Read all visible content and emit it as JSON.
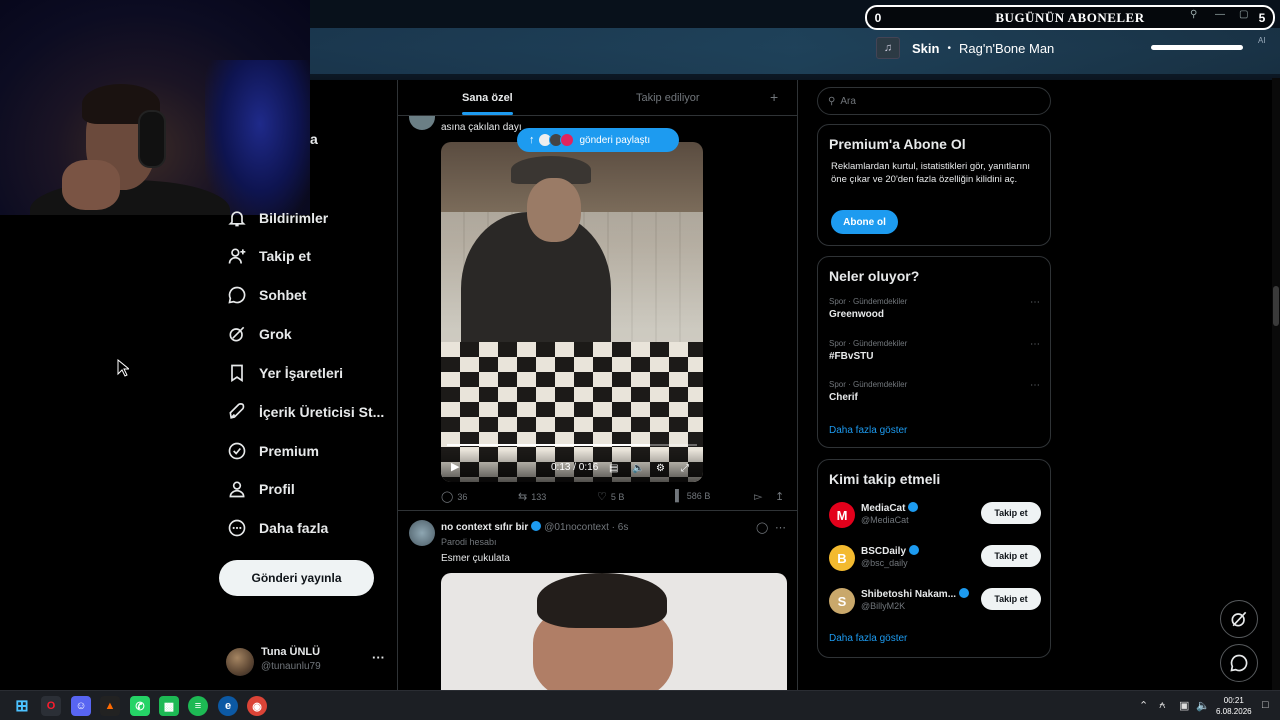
{
  "stream": {
    "subscriber_widget": {
      "count": "0",
      "title": "BUGÜNÜN ABONELER",
      "right_value": "5",
      "ai_tag": "AI"
    },
    "now_playing": {
      "song": "Skin",
      "separator": "•",
      "artist": "Rag'n'Bone Man"
    }
  },
  "nav": {
    "peek_text": "a",
    "items": [
      {
        "label": "Bildirimler",
        "icon": "bell-icon"
      },
      {
        "label": "Takip et",
        "icon": "person-plus-icon"
      },
      {
        "label": "Sohbet",
        "icon": "chat-icon"
      },
      {
        "label": "Grok",
        "icon": "grok-icon"
      },
      {
        "label": "Yer İşaretleri",
        "icon": "bookmark-icon"
      },
      {
        "label": "İçerik Üreticisi St...",
        "icon": "rocket-icon"
      },
      {
        "label": "Premium",
        "icon": "verified-icon"
      },
      {
        "label": "Profil",
        "icon": "person-icon"
      },
      {
        "label": "Daha fazla",
        "icon": "more-circle-icon"
      }
    ],
    "post_button": "Gönderi yayınla",
    "user": {
      "name": "Tuna ÜNLÜ",
      "handle": "@tunaunlu79",
      "more": "···"
    }
  },
  "feed": {
    "tabs": {
      "active": "Sana özel",
      "inactive": "Takip ediliyor",
      "add": "+"
    },
    "tweet1": {
      "text": "asına çakılan dayı",
      "share_pill": "gönderi paylaştı",
      "video": {
        "time": "0:13 / 0:16",
        "progress_fraction": 0.81
      },
      "stats": {
        "replies": "36",
        "reposts": "133",
        "likes": "5 B",
        "views": "586 B"
      }
    },
    "tweet2": {
      "name": "no context sıfır bir",
      "handle": "@01nocontext · 6s",
      "label": "Parodi hesabı",
      "text": "Esmer çukulata"
    }
  },
  "sidebar": {
    "search_placeholder": "Ara",
    "premium": {
      "title": "Premium'a Abone Ol",
      "description": "Reklamlardan kurtul, istatistikleri gör, yanıtlarını öne çıkar ve 20'den fazla özelliğin kilidini aç.",
      "button": "Abone ol"
    },
    "trends": {
      "title": "Neler oluyor?",
      "items": [
        {
          "category": "Spor · Gündemdekiler",
          "name": "Greenwood"
        },
        {
          "category": "Spor · Gündemdekiler",
          "name": "#FBvSTU"
        },
        {
          "category": "Spor · Gündemdekiler",
          "name": "Cherif"
        }
      ],
      "show_more": "Daha fazla göster"
    },
    "who_to_follow": {
      "title": "Kimi takip etmeli",
      "items": [
        {
          "name": "MediaCat",
          "handle": "@MediaCat",
          "button": "Takip et",
          "color": "#e3001b",
          "letter": "M"
        },
        {
          "name": "BSCDaily",
          "handle": "@bsc_daily",
          "button": "Takip et",
          "color": "#f3ba2f",
          "letter": "B"
        },
        {
          "name": "Shibetoshi Nakam...",
          "handle": "@BillyM2K",
          "button": "Takip et",
          "color": "#c9a86b",
          "letter": "S"
        }
      ],
      "show_more": "Daha fazla göster"
    }
  },
  "taskbar": {
    "time": "00:21",
    "date": "6.08.2026"
  },
  "colors": {
    "accent": "#1d9bf0",
    "background": "#000000",
    "border": "#2f3336",
    "muted": "#71767b"
  }
}
